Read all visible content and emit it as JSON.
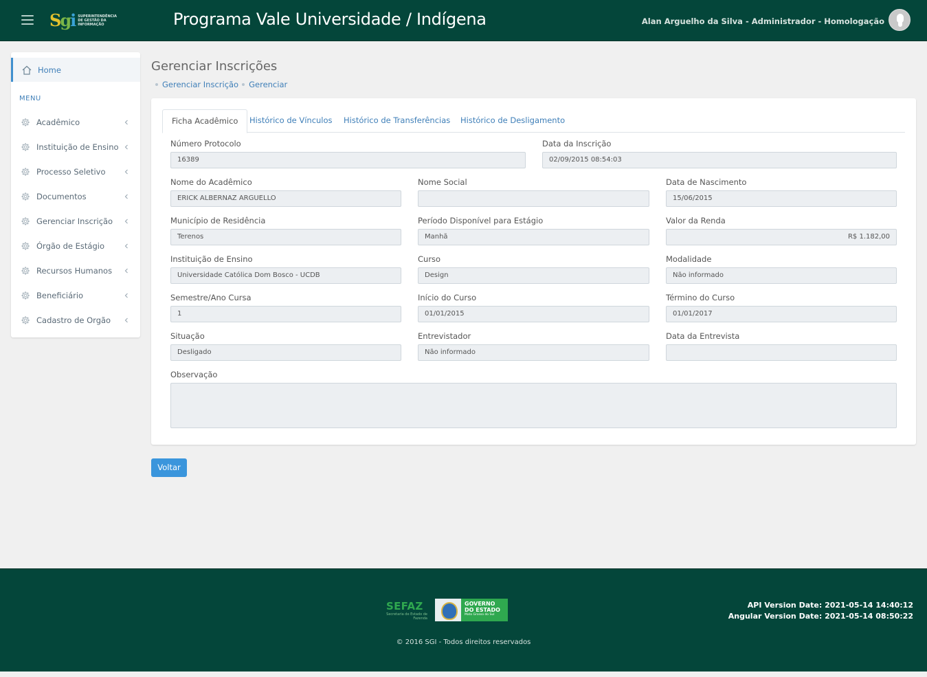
{
  "header": {
    "app_title": "Programa Vale Universidade / Indígena",
    "logo_text": "SUPERINTENDÊNCIA DE GESTÃO DA INFORMAÇÃO",
    "user_info": "Alan Arguelho da Silva - Administrador - Homologação"
  },
  "sidebar": {
    "home_label": "Home",
    "menu_heading": "MENU",
    "items": [
      {
        "label": "Acadêmico"
      },
      {
        "label": "Instituição de Ensino"
      },
      {
        "label": "Processo Seletivo"
      },
      {
        "label": "Documentos"
      },
      {
        "label": "Gerenciar Inscrição"
      },
      {
        "label": "Órgão de Estágio"
      },
      {
        "label": "Recursos Humanos"
      },
      {
        "label": "Beneficiário"
      },
      {
        "label": "Cadastro de Orgão"
      }
    ]
  },
  "page": {
    "title": "Gerenciar Inscrições",
    "breadcrumb": [
      "Gerenciar Inscrição",
      "Gerenciar"
    ]
  },
  "tabs": [
    {
      "label": "Ficha Acadêmico",
      "active": true
    },
    {
      "label": "Histórico de Vínculos",
      "active": false
    },
    {
      "label": "Histórico de Transferências",
      "active": false
    },
    {
      "label": "Histórico de Desligamento",
      "active": false
    }
  ],
  "form": {
    "numero_protocolo": {
      "label": "Número Protocolo",
      "value": "16389"
    },
    "data_inscricao": {
      "label": "Data da Inscrição",
      "value": "02/09/2015 08:54:03"
    },
    "nome_academico": {
      "label": "Nome do Acadêmico",
      "value": "ERICK ALBERNAZ ARGUELLO"
    },
    "nome_social": {
      "label": "Nome Social",
      "value": ""
    },
    "data_nascimento": {
      "label": "Data de Nascimento",
      "value": "15/06/2015"
    },
    "municipio": {
      "label": "Município de Residência",
      "value": "Terenos"
    },
    "periodo": {
      "label": "Período Disponível para Estágio",
      "value": "Manhã"
    },
    "valor_renda": {
      "label": "Valor da Renda",
      "value": "R$ 1.182,00"
    },
    "instituicao": {
      "label": "Instituição de Ensino",
      "value": "Universidade Católica Dom Bosco - UCDB"
    },
    "curso": {
      "label": "Curso",
      "value": "Design"
    },
    "modalidade": {
      "label": "Modalidade",
      "value": "Não informado"
    },
    "semestre": {
      "label": "Semestre/Ano Cursa",
      "value": "1"
    },
    "inicio_curso": {
      "label": "Início do Curso",
      "value": "01/01/2015"
    },
    "termino_curso": {
      "label": "Término do Curso",
      "value": "01/01/2017"
    },
    "situacao": {
      "label": "Situação",
      "value": "Desligado"
    },
    "entrevistador": {
      "label": "Entrevistador",
      "value": "Não informado"
    },
    "data_entrevista": {
      "label": "Data da Entrevista",
      "value": ""
    },
    "observacao": {
      "label": "Observação",
      "value": ""
    }
  },
  "actions": {
    "back_label": "Voltar"
  },
  "footer": {
    "sefaz_label": "SEFAZ",
    "sefaz_sub": "Secretaria de Estado de Fazenda",
    "gov_line1": "GOVERNO",
    "gov_line2": "DO ESTADO",
    "gov_sub": "Mato Grosso do Sul",
    "api_version": "API Version Date: 2021-05-14 14:40:12",
    "angular_version": "Angular Version Date: 2021-05-14 08:50:22",
    "copyright": "© 2016 SGI - Todos direitos reservados"
  },
  "colors": {
    "header_bg": "#04463a",
    "accent": "#3a95dc",
    "link": "#3f7fb8"
  }
}
